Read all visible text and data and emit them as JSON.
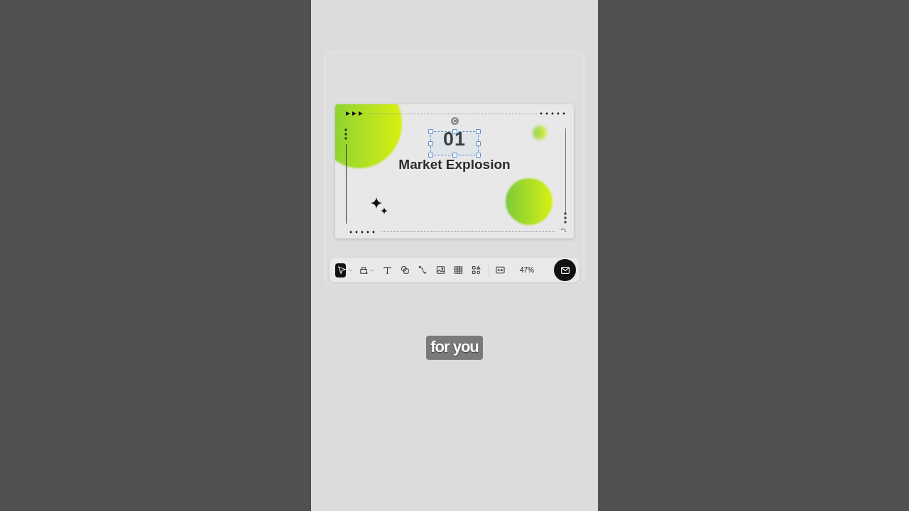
{
  "slide": {
    "number": "01",
    "number_selected": true,
    "title": "Market Explosion"
  },
  "toolbar": {
    "tools": [
      {
        "kind": "select",
        "selected": true,
        "dropdown": true
      },
      {
        "kind": "components",
        "selected": false,
        "dropdown": true
      },
      {
        "kind": "text",
        "selected": false,
        "dropdown": false
      },
      {
        "kind": "shape",
        "selected": false,
        "dropdown": false
      },
      {
        "kind": "connector",
        "selected": false,
        "dropdown": false
      },
      {
        "kind": "image",
        "selected": false,
        "dropdown": false
      },
      {
        "kind": "table",
        "selected": false,
        "dropdown": false
      },
      {
        "kind": "widgets",
        "selected": false,
        "dropdown": false
      },
      {
        "kind": "fit",
        "selected": false,
        "dropdown": false
      }
    ],
    "zoom": "47%"
  },
  "caption": "for you"
}
